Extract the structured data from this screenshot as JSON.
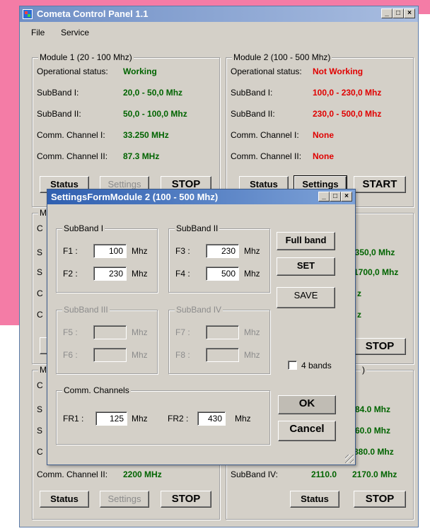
{
  "app": {
    "title": "Cometa Control Panel 1.1",
    "menu": [
      "File",
      "Service"
    ]
  },
  "colors": {
    "working": "#006400",
    "not_working": "#e00000"
  },
  "module1": {
    "legend": "Module 1 (20 - 100 Mhz)",
    "status_label": "Operational status:",
    "status_value": "Working",
    "sub1_label": "SubBand I:",
    "sub1_value": "20,0 - 50,0 Mhz",
    "sub2_label": "SubBand II:",
    "sub2_value": "50,0 - 100,0 Mhz",
    "ch1_label": "Comm. Channel I:",
    "ch1_value": "33.250 MHz",
    "ch2_label": "Comm. Channel II:",
    "ch2_value": "87.3 MHz",
    "btn_status": "Status",
    "btn_settings": "Settings",
    "btn_action": "STOP"
  },
  "module2": {
    "legend": "Module 2 (100 - 500 Mhz)",
    "status_label": "Operational status:",
    "status_value": "Not Working",
    "sub1_label": "SubBand I:",
    "sub1_value": "100,0 - 230,0 Mhz",
    "sub2_label": "SubBand II:",
    "sub2_value": "230,0 - 500,0 Mhz",
    "ch1_label": "Comm. Channel I:",
    "ch1_value": "None",
    "ch2_label": "Comm. Channel II:",
    "ch2_value": "None",
    "btn_status": "Status",
    "btn_settings": "Settings",
    "btn_action": "START"
  },
  "module3": {
    "legend_partial": "M",
    "row_partial": [
      "C",
      "S",
      "S",
      "C",
      "C"
    ]
  },
  "module4": {
    "values_partial": [
      "1350,0 Mhz",
      "1700,0 Mhz",
      "z",
      "z"
    ],
    "btn_action": "STOP"
  },
  "module5": {
    "legend_partial": "M",
    "row_partial": [
      "C",
      "S",
      "S",
      "C"
    ],
    "ch2_label": "Comm. Channel II:",
    "ch2_value": "2200 MHz",
    "btn_status": "Status",
    "btn_settings": "Settings",
    "btn_action": "STOP"
  },
  "module6": {
    "legend_partial": ")",
    "values_partial": [
      "84.0 Mhz",
      "60.0 Mhz",
      "880.0 Mhz",
      "2170.0 Mhz"
    ],
    "sub4_label": "SubBand IV:",
    "sub4_value": "2110.0",
    "btn_status": "Status",
    "btn_action": "STOP"
  },
  "dialog": {
    "title": "SettingsFormModule 2 (100 - 500 Mhz)",
    "sb1": {
      "legend": "SubBand I",
      "f1_label": "F1 :",
      "f1_value": "100",
      "f2_label": "F2 :",
      "f2_value": "230",
      "unit": "Mhz"
    },
    "sb2": {
      "legend": "SubBand II",
      "f3_label": "F3 :",
      "f3_value": "230",
      "f4_label": "F4 :",
      "f4_value": "500",
      "unit": "Mhz"
    },
    "sb3": {
      "legend": "SubBand III",
      "f5_label": "F5 :",
      "f6_label": "F6 :",
      "unit": "Mhz"
    },
    "sb4": {
      "legend": "SubBand IV",
      "f7_label": "F7 :",
      "f8_label": "F8 :",
      "unit": "Mhz"
    },
    "comm": {
      "legend": "Comm. Channels",
      "fr1_label": "FR1 :",
      "fr1_value": "125",
      "fr2_label": "FR2 :",
      "fr2_value": "430",
      "unit": "Mhz"
    },
    "btn_full_band": "Full band",
    "btn_set": "SET",
    "btn_save": "SAVE",
    "chk_4bands": "4 bands",
    "btn_ok": "OK",
    "btn_cancel": "Cancel"
  }
}
